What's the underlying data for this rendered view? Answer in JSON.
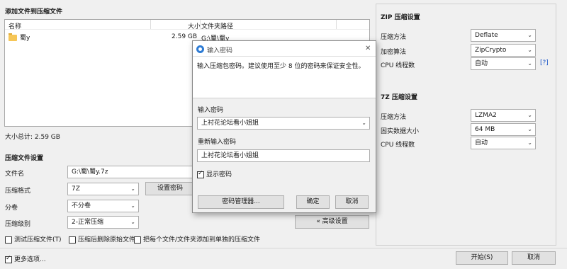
{
  "left": {
    "add_files_title": "添加文件到压缩文件",
    "columns": {
      "name": "名称",
      "size": "大小",
      "path": "文件夹路径"
    },
    "rows": [
      {
        "name": "蜀y",
        "size": "2.59 GB",
        "path": "G:\\蜀\\蜀y"
      }
    ],
    "total_size": "大小总计: 2.59 GB",
    "settings_title": "压缩文件设置",
    "filename_label": "文件名",
    "filename_value": "G:\\蜀\\蜀y.7z",
    "format_label": "压缩格式",
    "format_value": "7Z",
    "set_password_label": "设置密码",
    "split_label": "分卷",
    "split_value": "不分卷",
    "level_label": "压缩级别",
    "level_value": "2-正常压缩",
    "advanced_label": "« 高级设置",
    "test_label": "测试压缩文件(T)",
    "delete_label": "压缩后删除原始文件",
    "separate_label": "把每个文件/文件夹添加到单独的压缩文件",
    "more_options_label": "更多选项..."
  },
  "right": {
    "zip_title": "ZIP 压缩设置",
    "zip_method_label": "压缩方法",
    "zip_method_value": "Deflate",
    "zip_encrypt_label": "加密算法",
    "zip_encrypt_value": "ZipCrypto",
    "zip_cpu_label": "CPU 线程数",
    "zip_cpu_value": "自动",
    "help_link": "[?]",
    "sevenz_title": "7Z 压缩设置",
    "sevenz_method_label": "压缩方法",
    "sevenz_method_value": "LZMA2",
    "sevenz_solid_label": "固实数据大小",
    "sevenz_solid_value": "64 MB",
    "sevenz_cpu_label": "CPU 线程数",
    "sevenz_cpu_value": "自动"
  },
  "footer": {
    "start_label": "开始(S)",
    "cancel_label": "取消"
  },
  "dialog": {
    "title": "输入密码",
    "close_glyph": "✕",
    "hint": "输入压缩包密码。建议使用至少 8 位的密码来保证安全性。",
    "password_label": "输入密码",
    "password_value": "上衬花论坛看小姐姐",
    "repeat_label": "重新输入密码",
    "repeat_value": "上衬花论坛看小姐姐",
    "show_password_label": "显示密码",
    "manager_label": "密码管理器...",
    "ok_label": "确定",
    "cancel_label": "取消"
  },
  "colors": {
    "accent": "#2d7bd4",
    "folder": "#f6c657",
    "link": "#1a56c9"
  },
  "icons": [
    "folder-icon",
    "key-icon",
    "close-icon",
    "chevron-down-icon",
    "checkbox-icon"
  ]
}
